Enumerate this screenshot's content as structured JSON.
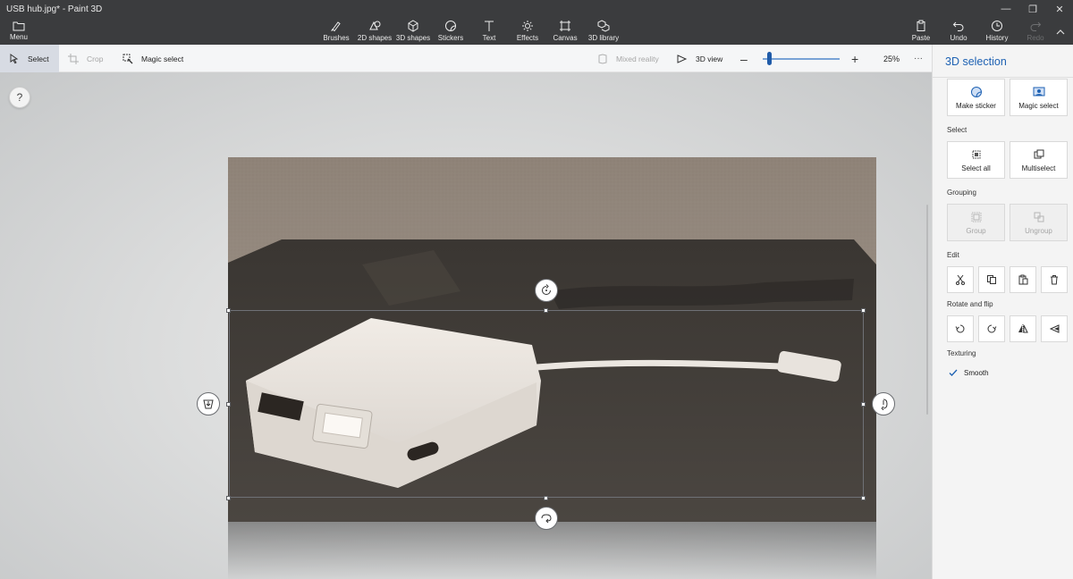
{
  "window": {
    "title": "USB hub.jpg* - Paint 3D",
    "controls": [
      "minimize-icon",
      "restore-icon",
      "close-icon"
    ]
  },
  "ribbon": {
    "menu_label": "Menu",
    "tools": [
      {
        "label": "Brushes",
        "icon": "brush-icon"
      },
      {
        "label": "2D shapes",
        "icon": "2d-shapes-icon"
      },
      {
        "label": "3D shapes",
        "icon": "3d-shapes-icon"
      },
      {
        "label": "Stickers",
        "icon": "sticker-icon"
      },
      {
        "label": "Text",
        "icon": "text-icon"
      },
      {
        "label": "Effects",
        "icon": "effects-icon"
      },
      {
        "label": "Canvas",
        "icon": "canvas-icon"
      },
      {
        "label": "3D library",
        "icon": "3d-library-icon"
      }
    ],
    "actions": [
      {
        "label": "Paste",
        "icon": "paste-icon",
        "enabled": true
      },
      {
        "label": "Undo",
        "icon": "undo-icon",
        "enabled": true
      },
      {
        "label": "History",
        "icon": "history-icon",
        "enabled": true
      },
      {
        "label": "Redo",
        "icon": "redo-icon",
        "enabled": false
      }
    ]
  },
  "toolbar": {
    "select_label": "Select",
    "crop_label": "Crop",
    "magic_select_label": "Magic select",
    "mixed_reality_label": "Mixed reality",
    "view_3d_label": "3D view",
    "zoom_level": "25%",
    "zoom_fraction": 0.05,
    "more_label": "···"
  },
  "canvas": {
    "help_label": "?",
    "gizmos": [
      "rotate-z-icon",
      "rotate-y-icon",
      "rotate-x-icon",
      "push-back-icon"
    ]
  },
  "panel": {
    "title": "3D selection",
    "make_sticker_label": "Make sticker",
    "magic_select_label": "Magic select",
    "select_section": "Select",
    "select_all_label": "Select all",
    "multiselect_label": "Multiselect",
    "grouping_section": "Grouping",
    "group_label": "Group",
    "ungroup_label": "Ungroup",
    "edit_section": "Edit",
    "edit_icons": [
      "cut-icon",
      "copy-icon",
      "paste-icon",
      "delete-icon"
    ],
    "rotate_section": "Rotate and flip",
    "rotate_icons": [
      "rotate-left-icon",
      "rotate-right-icon",
      "flip-horizontal-icon",
      "flip-vertical-icon"
    ],
    "texturing_section": "Texturing",
    "smooth_label": "Smooth",
    "smooth_checked": true
  },
  "colors": {
    "accent": "#1f62b3",
    "ribbon_bg": "#3b3c3e",
    "panel_bg": "#f4f4f4"
  }
}
